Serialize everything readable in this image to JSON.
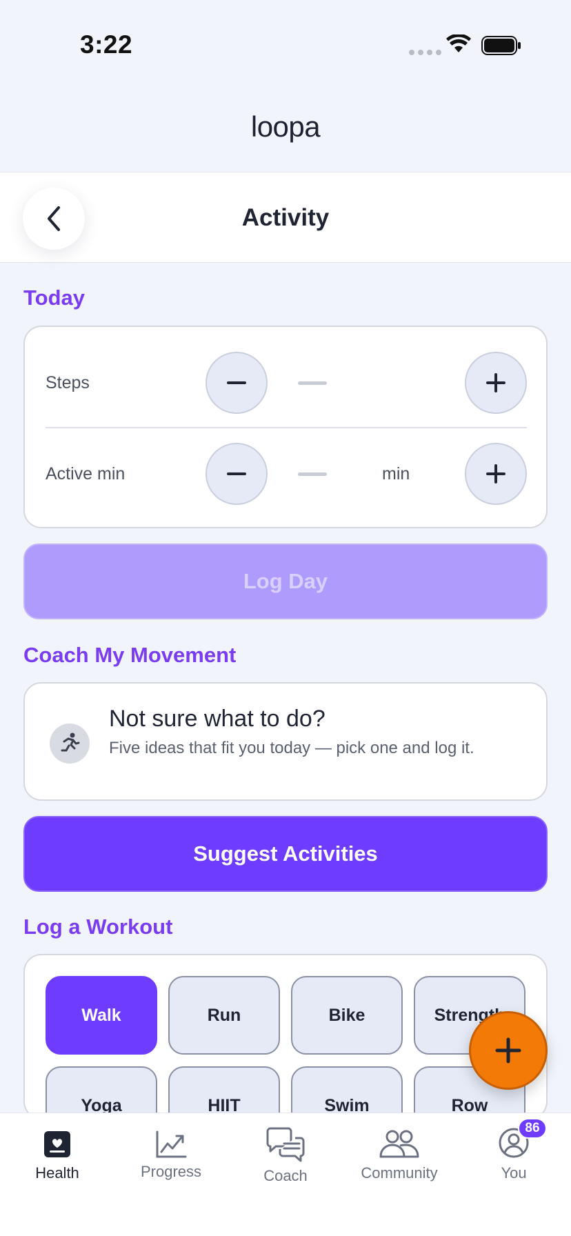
{
  "status_bar": {
    "time": "3:22"
  },
  "app": {
    "logo_text": "loopa"
  },
  "header": {
    "title": "Activity"
  },
  "today": {
    "section_title": "Today",
    "rows": [
      {
        "label": "Steps",
        "value": "—",
        "unit": ""
      },
      {
        "label": "Active min",
        "value": "—",
        "unit": "min"
      }
    ],
    "log_button": "Log Day"
  },
  "coach": {
    "section_title": "Coach My Movement",
    "heading": "Not sure what to do?",
    "subtext": "Five ideas that fit you today — pick one and log it.",
    "icon": "runner-icon",
    "suggest_button": "Suggest Activities"
  },
  "workouts": {
    "section_title": "Log a Workout",
    "items": [
      {
        "label": "Walk",
        "selected": true
      },
      {
        "label": "Run",
        "selected": false
      },
      {
        "label": "Bike",
        "selected": false
      },
      {
        "label": "Strength",
        "selected": false
      },
      {
        "label": "Yoga",
        "selected": false
      },
      {
        "label": "HIIT",
        "selected": false
      },
      {
        "label": "Swim",
        "selected": false
      },
      {
        "label": "Row",
        "selected": false
      }
    ]
  },
  "nav": {
    "items": [
      {
        "label": "Health",
        "icon": "health-icon",
        "active": true
      },
      {
        "label": "Progress",
        "icon": "chart-icon",
        "active": false
      },
      {
        "label": "Coach",
        "icon": "chat-icon",
        "active": false
      },
      {
        "label": "Community",
        "icon": "people-icon",
        "active": false
      },
      {
        "label": "You",
        "icon": "profile-icon",
        "active": false
      }
    ],
    "you_badge": "86"
  },
  "colors": {
    "accent": "#6e3cff",
    "section_title": "#7a3cf0",
    "fab": "#f47a07",
    "disabled_button": "#ae9bfb"
  }
}
